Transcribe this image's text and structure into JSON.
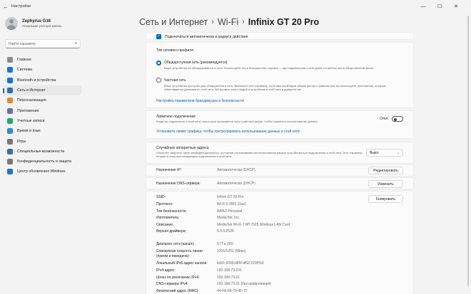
{
  "window": {
    "title": "Настройки",
    "back_icon": "arrow-left-icon",
    "controls": [
      "minimize-icon",
      "maximize-icon",
      "close-icon"
    ]
  },
  "profile": {
    "name": "Zephyrus G16",
    "subtitle": "Локальная учетная запись"
  },
  "search": {
    "placeholder": "Найти параметр"
  },
  "nav": {
    "items": [
      {
        "label": "Главная",
        "icon": "home-icon",
        "color": "#8a8a8a"
      },
      {
        "label": "Система",
        "icon": "monitor-icon",
        "color": "#1b73d8"
      },
      {
        "label": "Bluetooth и устройства",
        "icon": "bluetooth-icon",
        "color": "#1b73d8"
      },
      {
        "label": "Сеть и Интернет",
        "icon": "wifi-icon",
        "color": "#2f6fb3",
        "active": true
      },
      {
        "label": "Персонализация",
        "icon": "brush-icon",
        "color": "#e08a3c"
      },
      {
        "label": "Приложения",
        "icon": "apps-icon",
        "color": "#6a6fa8"
      },
      {
        "label": "Учетные записи",
        "icon": "person-icon",
        "color": "#2aa36f"
      },
      {
        "label": "Время и язык",
        "icon": "globe-clock-icon",
        "color": "#2a8fd6"
      },
      {
        "label": "Игры",
        "icon": "gamepad-icon",
        "color": "#777777"
      },
      {
        "label": "Специальные возможности",
        "icon": "accessibility-icon",
        "color": "#3a6ea5"
      },
      {
        "label": "Конфиденциальность и защита",
        "icon": "shield-icon",
        "color": "#777777"
      },
      {
        "label": "Центр обновления Windows",
        "icon": "update-icon",
        "color": "#1b73d8"
      }
    ]
  },
  "breadcrumb": {
    "items": [
      "Сеть и Интернет",
      "Wi-Fi"
    ],
    "current": "Infinix GT 20 Pro"
  },
  "auto_connect": {
    "label": "Подключаться автоматически в радиусе действия",
    "checked": true
  },
  "profile_type": {
    "title": "Тип сетевого профиля",
    "public": {
      "label": "Общедоступная сеть (рекомендуется)",
      "desc": "Ваше устройство не обнаруживается в сети. Используйте это в большинстве случаев — при подключении к сети дома, на работе или в общественном месте.",
      "selected": true
    },
    "private": {
      "label": "Частная сеть",
      "desc": "Ваше устройство доступно для обнаружения в сети. Выберите этот параметр, если вам необходим общий доступ к файлам или вы используете приложения, которые обмениваются данными по этой сети. Вы должны знать людей и устройства в этой сети и доверять им.",
      "selected": false
    },
    "firewall_link": "Настройка параметров брандмауэра и безопасности"
  },
  "metered": {
    "label": "Лимитное подключение",
    "desc": "Когда вы подключены к этой сети, некоторые приложения могут работать иначе, чтобы сократить использование данных",
    "state": "Откл.",
    "link": "Установите лимит трафика, чтобы контролировать использование данных в этой сети"
  },
  "random_mac": {
    "label": "Случайные аппаратные адреса",
    "desc": "Помогите защитить свою конфиденциальность, усложнив отслеживание местоположения вашего устройства при подключении к этой сети. Этот параметр вступит в силу при следующем подключении к этой сети.",
    "value": "Выкл."
  },
  "ip": {
    "label": "Назначение IP:",
    "value": "Автоматически (DHCP)",
    "button": "Редактировать"
  },
  "dns": {
    "label": "Назначение DNS-сервера:",
    "value": "Автоматически (DHCP)",
    "button": "Изменить"
  },
  "properties": {
    "copy_button": "Копировать",
    "rows": [
      {
        "label": "SSID:",
        "value": "Infinix GT 20 Pro"
      },
      {
        "label": "Протокол:",
        "value": "Wi-Fi 6 (802.11ax)"
      },
      {
        "label": "Тип безопасности:",
        "value": "WPA2-Personal"
      },
      {
        "label": "Изготовитель:",
        "value": "MediaTek, Inc."
      },
      {
        "label": "Описание:",
        "value": "MediaTek Wi-Fi 7 MT7925 Wireless LAN Card"
      },
      {
        "label": "Версия драйвера:",
        "value": "5.4.0.2539"
      }
    ],
    "rows2": [
      {
        "label": "Диапазон сети (канал):",
        "value": "5 ГГц (36)"
      },
      {
        "label": "Совокупная скорость линии\n(прием и передача):",
        "value": "1201/1201 (Mbps)"
      },
      {
        "label": "Локальный IPv6-адрес канала:",
        "value": "fe80::6098:d85f:df62:2200%5"
      },
      {
        "label": "IPv4-адрес:",
        "value": "192.168.73.231"
      },
      {
        "label": "Шлюз по умолчанию IPv4:",
        "value": "192.168.73.31"
      },
      {
        "label": "DNS-серверы IPv4:",
        "value": "192.168.73.31 (без шифрования)"
      },
      {
        "label": "Физический адрес (MAC):",
        "value": "44-FA-66-70-4F-77"
      }
    ]
  }
}
